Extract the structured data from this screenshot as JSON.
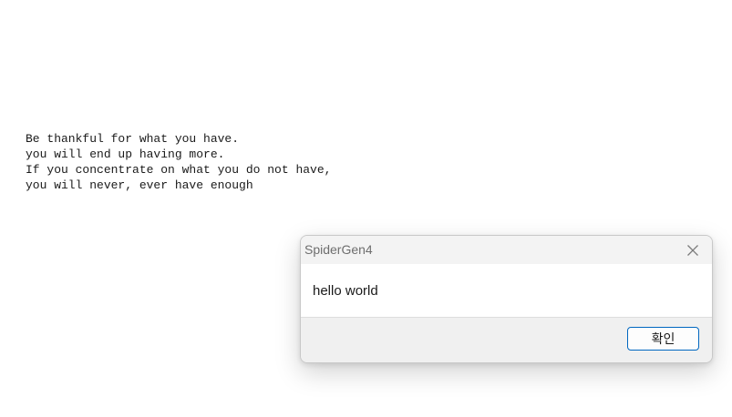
{
  "document": {
    "lines": [
      "Be thankful for what you have.",
      "you will end up having more.",
      "If you concentrate on what you do not have,",
      "you will never, ever have enough"
    ]
  },
  "dialog": {
    "title": "SpiderGen4",
    "message": "hello world",
    "ok_label": "확인",
    "close_icon": "close-icon",
    "accent_color": "#0067c0"
  }
}
